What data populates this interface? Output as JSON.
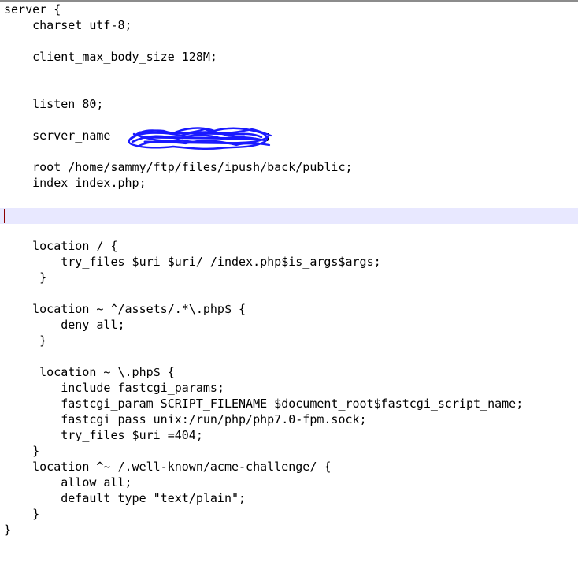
{
  "editor": {
    "lines": [
      "server {",
      "    charset utf-8;",
      "",
      "    client_max_body_size 128M;",
      "",
      "",
      "    listen 80;",
      "",
      "    server_name ",
      "",
      "    root /home/sammy/ftp/files/ipush/back/public;",
      "    index index.php;",
      "",
      "",
      "",
      "    location / {",
      "        try_files $uri $uri/ /index.php$is_args$args;",
      "     }",
      "",
      "    location ~ ^/assets/.*\\.php$ {",
      "        deny all;",
      "     }",
      "",
      "     location ~ \\.php$ {",
      "        include fastcgi_params;",
      "        fastcgi_param SCRIPT_FILENAME $document_root$fastcgi_script_name;",
      "        fastcgi_pass unix:/run/php/php7.0-fpm.sock;",
      "        try_files $uri =404;",
      "    }",
      "    location ^~ /.well-known/acme-challenge/ {",
      "        allow all;",
      "        default_type \"text/plain\";",
      "    }",
      "}"
    ],
    "server_name_suffix": ";",
    "current_line_color": "#e8e8ff",
    "redaction_color": "#1a1aff",
    "caret_color": "#8b0000"
  }
}
